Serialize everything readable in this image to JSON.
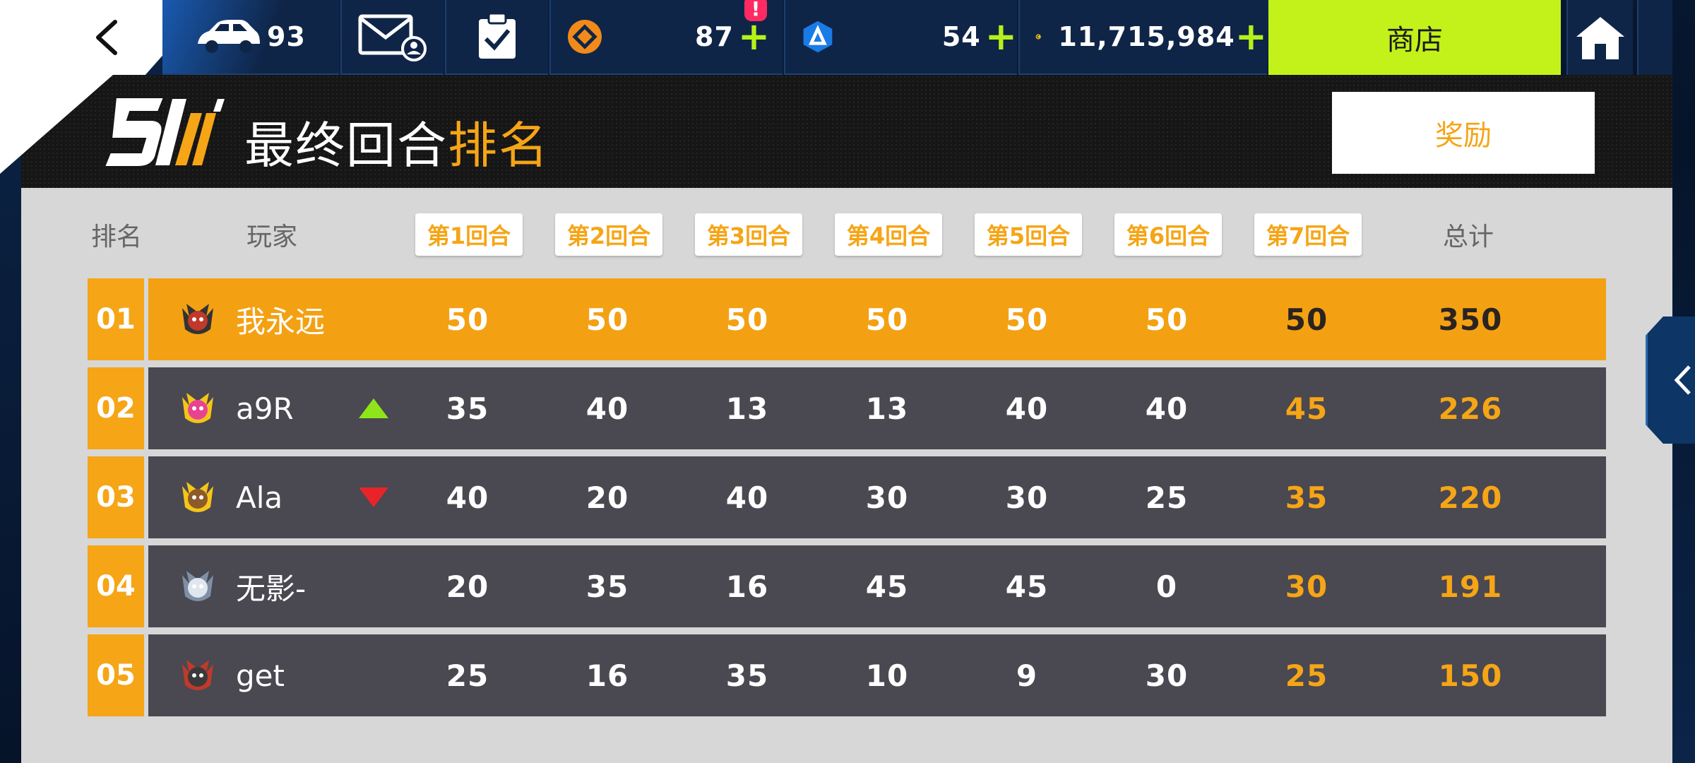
{
  "topbar": {
    "cars_count": "93",
    "token1": "87",
    "token2": "54",
    "credits": "11,715,984",
    "plus": "+",
    "badge": "!",
    "shop_label": "商店"
  },
  "header": {
    "title_main": "最终回合",
    "title_highlight": "排名",
    "reward_label": "奖励"
  },
  "table": {
    "col_rank": "排名",
    "col_player": "玩家",
    "rounds": [
      "第1回合",
      "第2回合",
      "第3回合",
      "第4回合",
      "第5回合",
      "第6回合",
      "第7回合"
    ],
    "col_total": "总计",
    "rows": [
      {
        "rank": "01",
        "name": "我永远",
        "trend": "none",
        "scores": [
          "50",
          "50",
          "50",
          "50",
          "50",
          "50",
          "50"
        ],
        "total": "350"
      },
      {
        "rank": "02",
        "name": "a9R",
        "trend": "up",
        "scores": [
          "35",
          "40",
          "13",
          "13",
          "40",
          "40",
          "45"
        ],
        "total": "226"
      },
      {
        "rank": "03",
        "name": "Ala",
        "trend": "down",
        "scores": [
          "40",
          "20",
          "40",
          "30",
          "30",
          "25",
          "35"
        ],
        "total": "220"
      },
      {
        "rank": "04",
        "name": "无影-",
        "trend": "none",
        "scores": [
          "20",
          "35",
          "16",
          "45",
          "45",
          "0",
          "30"
        ],
        "total": "191"
      },
      {
        "rank": "05",
        "name": "get",
        "trend": "none",
        "scores": [
          "25",
          "16",
          "35",
          "10",
          "9",
          "30",
          "25"
        ],
        "total": "150"
      }
    ]
  },
  "colors": {
    "accent": "#f5a516",
    "shop": "#c2f21a",
    "row": "#4a4850",
    "up": "#8ee61a",
    "down": "#e8242a"
  }
}
